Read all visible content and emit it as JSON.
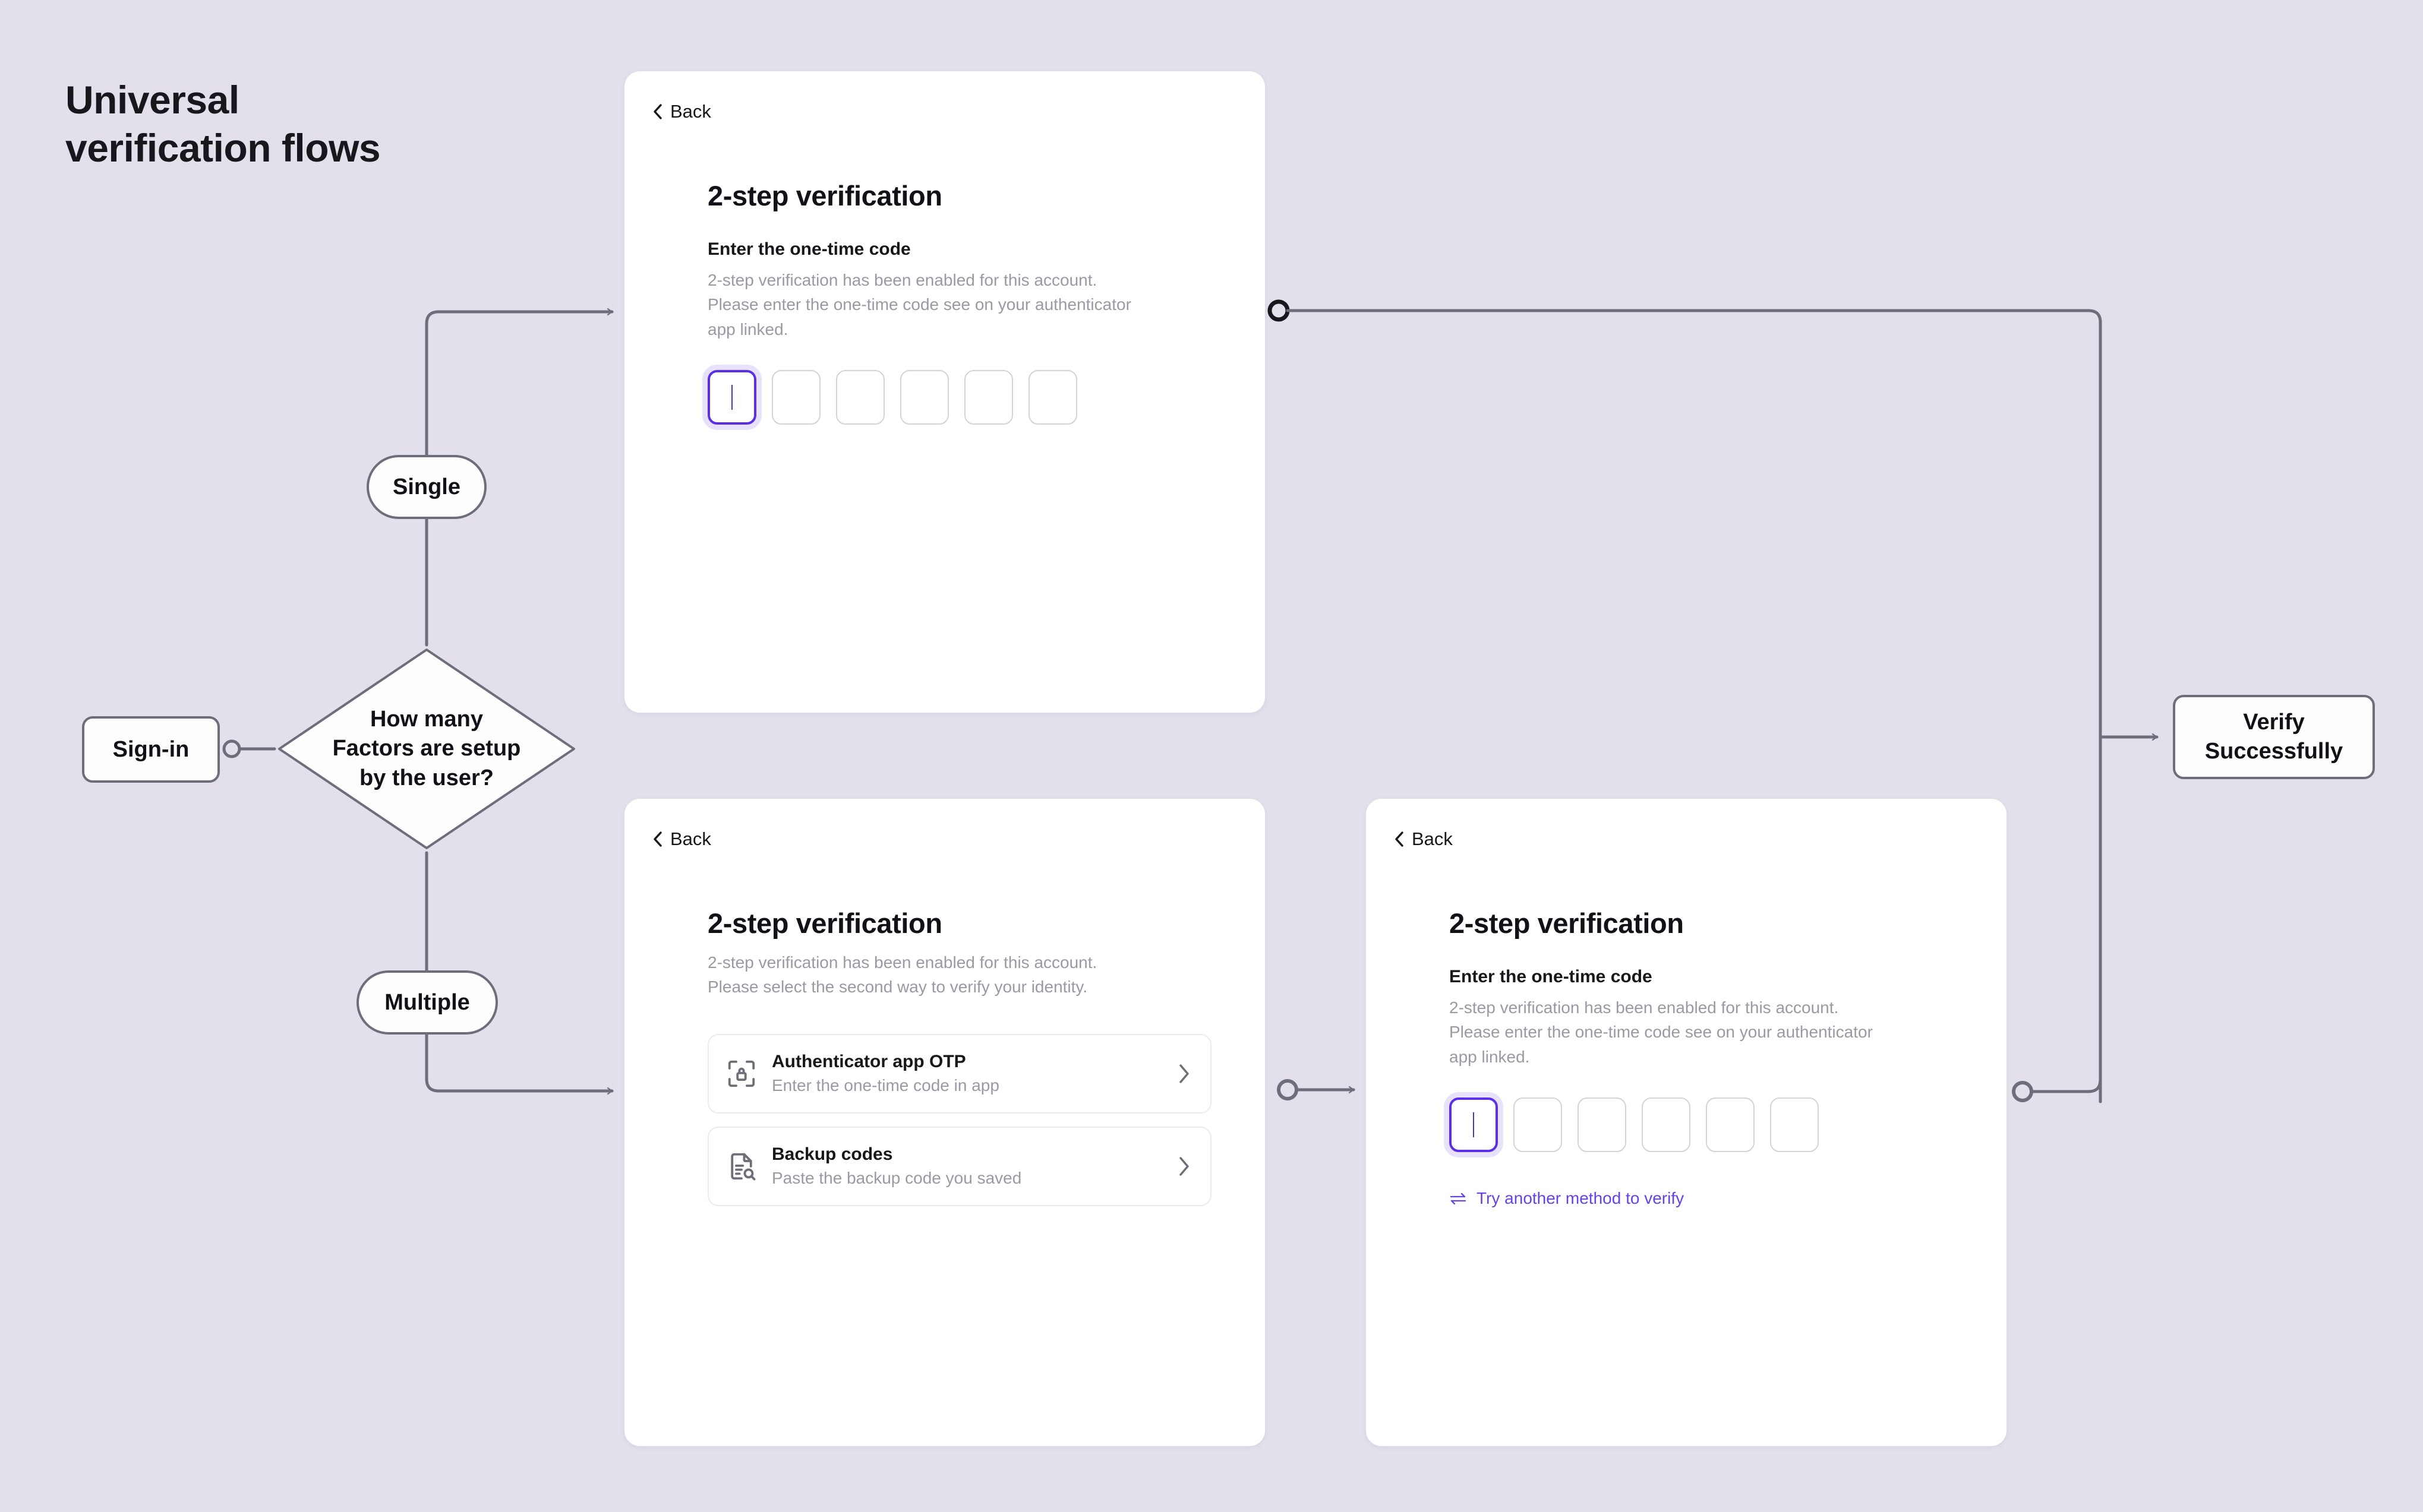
{
  "page": {
    "title": "Universal\nverification flows",
    "background_color": "#e3e0ec",
    "accent_color": "#6742e8",
    "node_border_color": "#6d6d7c",
    "muted_text_color": "#9a9aa6"
  },
  "flow": {
    "start_node": {
      "label": "Sign-in",
      "name": "sign-in"
    },
    "decision_node": {
      "label": "How many\nFactors are setup\nby the user?",
      "name": "factor-count-decision"
    },
    "branch_single": {
      "label": "Single",
      "name": "single"
    },
    "branch_multiple": {
      "label": "Multiple",
      "name": "multiple"
    },
    "end_node": {
      "label": "Verify\nSuccessfully",
      "name": "verify-successfully"
    }
  },
  "cards": {
    "single_factor": {
      "back_label": "Back",
      "title": "2-step verification",
      "sub_head": "Enter the one-time code",
      "body": "2-step verification has been enabled for this account.\nPlease enter the one-time code see on your authenticator\napp linked.",
      "otp": {
        "length": 6,
        "focused_index": 0,
        "values": [
          "",
          "",
          "",
          "",
          "",
          ""
        ]
      }
    },
    "method_select": {
      "back_label": "Back",
      "title": "2-step verification",
      "body": "2-step verification has been enabled for this account.\nPlease select the second way to verify your identity.",
      "methods": [
        {
          "icon": "scan-lock-icon",
          "title": "Authenticator app OTP",
          "subtitle": "Enter the one-time code in app",
          "chevron": "chevron-right-icon"
        },
        {
          "icon": "file-search-icon",
          "title": "Backup codes",
          "subtitle": "Paste the backup code you saved",
          "chevron": "chevron-right-icon"
        }
      ]
    },
    "multi_factor": {
      "back_label": "Back",
      "title": "2-step verification",
      "sub_head": "Enter the one-time code",
      "body": "2-step verification has been enabled for this account.\nPlease enter the one-time code see on your authenticator\napp linked.",
      "otp": {
        "length": 6,
        "focused_index": 0,
        "values": [
          "",
          "",
          "",
          "",
          "",
          ""
        ]
      },
      "alt_link": {
        "icon": "swap-arrows-icon",
        "label": "Try another method to verify"
      }
    }
  }
}
